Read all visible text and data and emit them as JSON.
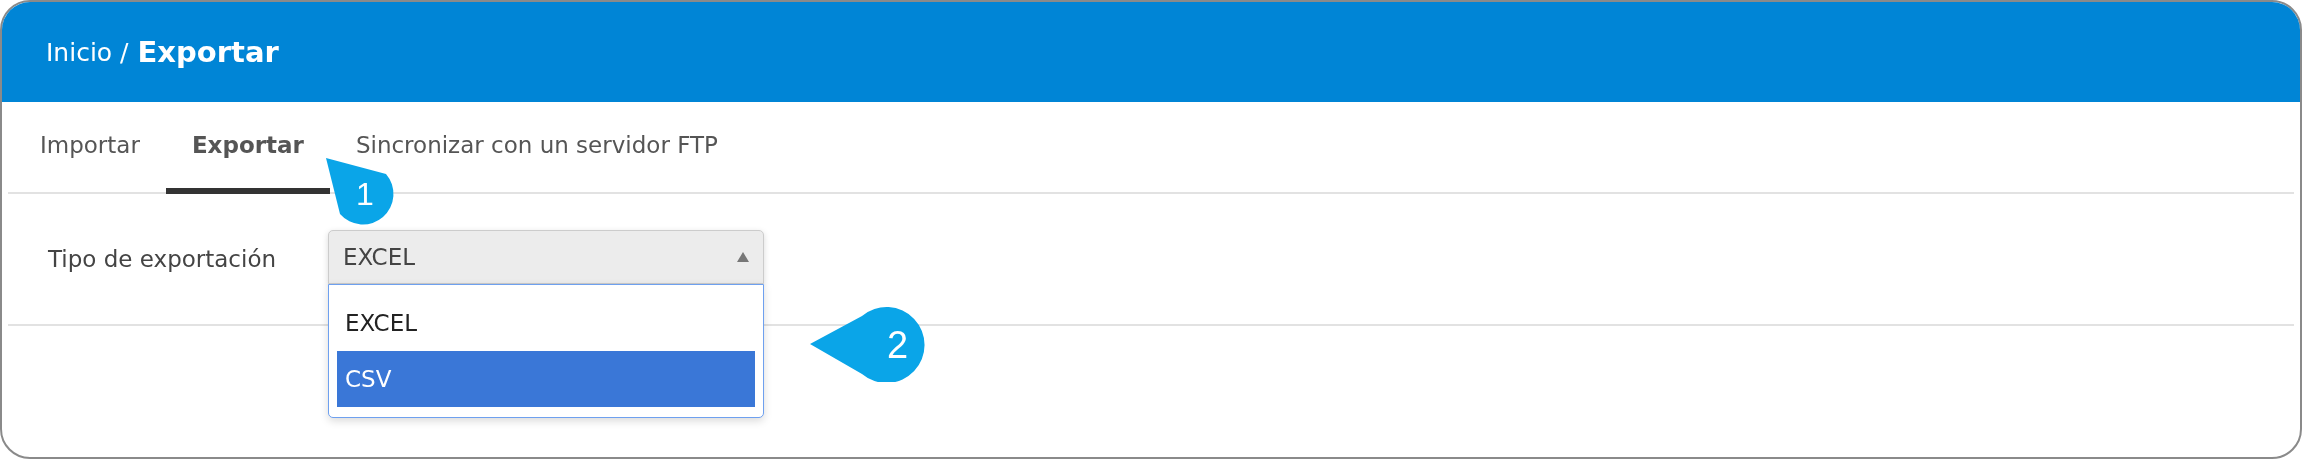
{
  "header": {
    "breadcrumb_parent": "Inicio /",
    "breadcrumb_current": "Exportar"
  },
  "tabs": [
    {
      "label": "Importar",
      "selected": false
    },
    {
      "label": "Exportar",
      "selected": true
    },
    {
      "label": "Sincronizar con un servidor FTP",
      "selected": false
    }
  ],
  "form": {
    "label": "Tipo de exportación",
    "select": {
      "value": "EXCEL",
      "expanded": true,
      "options": [
        {
          "label": "EXCEL",
          "highlighted": false
        },
        {
          "label": "CSV",
          "highlighted": true
        }
      ]
    }
  },
  "callouts": [
    {
      "label": "1"
    },
    {
      "label": "2"
    }
  ]
}
